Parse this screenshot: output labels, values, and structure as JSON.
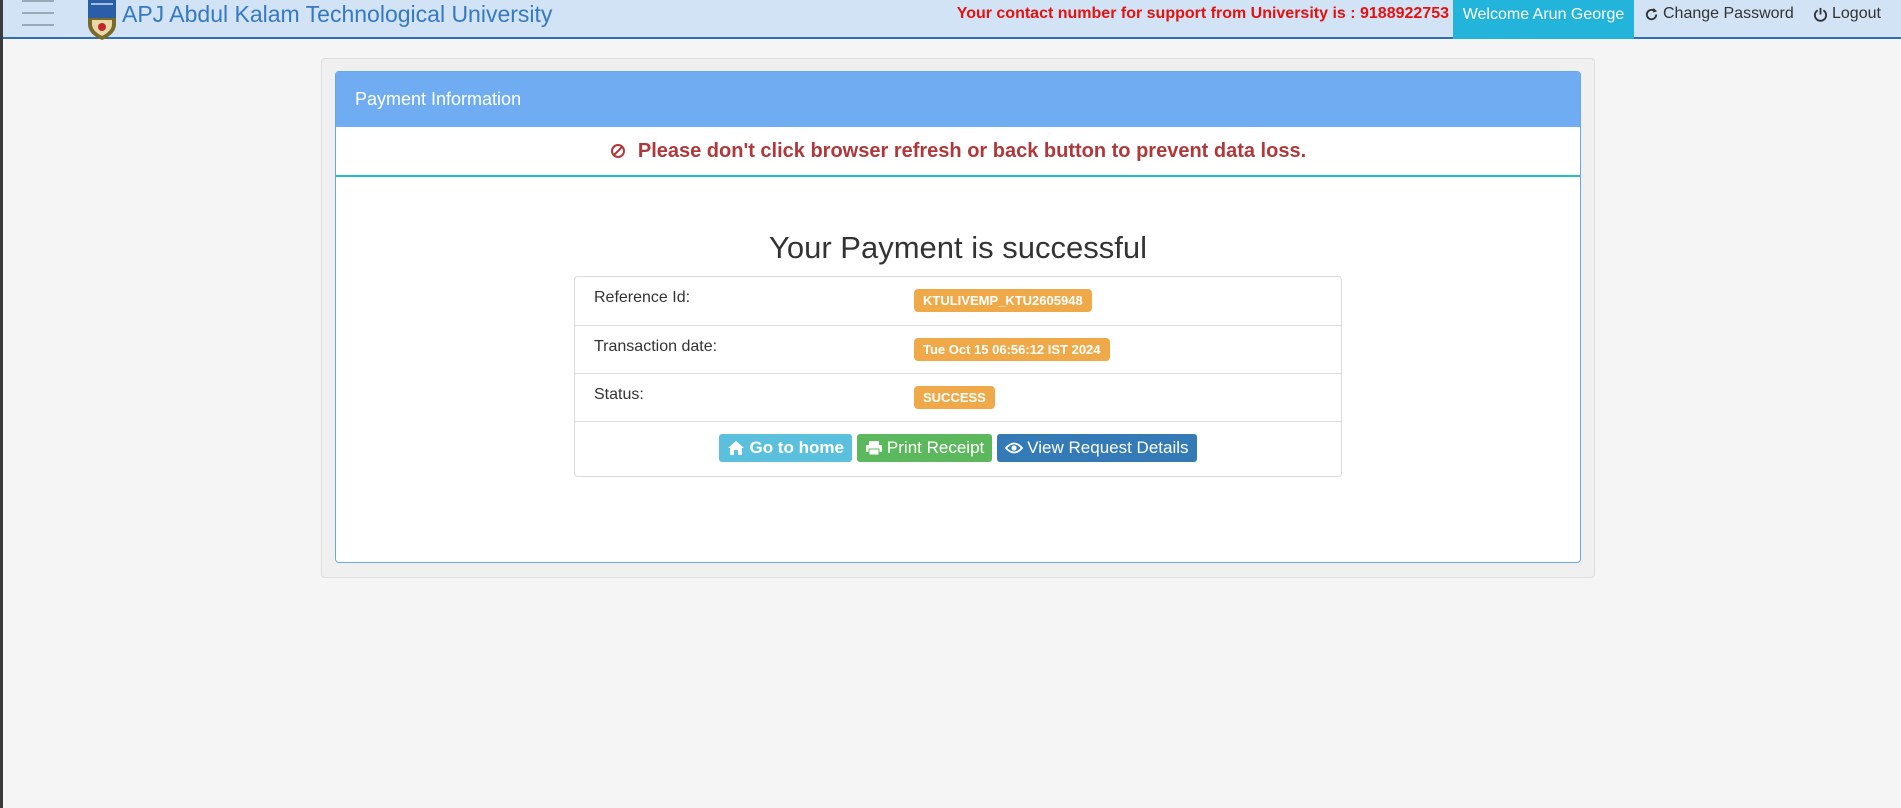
{
  "header": {
    "brand": "APJ Abdul Kalam Technological University",
    "support_text": "Your contact number for support from University is : 9188922753",
    "welcome": "Welcome Arun George",
    "change_password": "Change Password",
    "logout": "Logout"
  },
  "panel": {
    "title": "Payment Information",
    "warning": "Please don't click browser refresh or back button to prevent data loss.",
    "success_title": "Your Payment is successful",
    "rows": [
      {
        "label": "Reference Id:",
        "value": "KTULIVEMP_KTU2605948"
      },
      {
        "label": "Transaction date:",
        "value": "Tue Oct 15 06:56:12 IST 2024"
      },
      {
        "label": "Status:",
        "value": "SUCCESS"
      }
    ],
    "buttons": {
      "home": "Go to home",
      "print": "Print Receipt",
      "view": "View Request Details"
    }
  },
  "colors": {
    "header_bg": "#d1e3f5",
    "brand": "#3679c2",
    "support": "#e4110f",
    "welcome_bg": "#23b4dc",
    "panel_heading": "#70acf2",
    "warning": "#b0383a",
    "badge": "#efa949",
    "home_btn": "#5bc0de",
    "print_btn": "#5cb85c",
    "view_btn": "#337ab7"
  },
  "icons": [
    "menu-icon",
    "university-logo",
    "refresh-icon",
    "power-icon",
    "ban-icon",
    "home-icon",
    "print-icon",
    "eye-icon"
  ]
}
